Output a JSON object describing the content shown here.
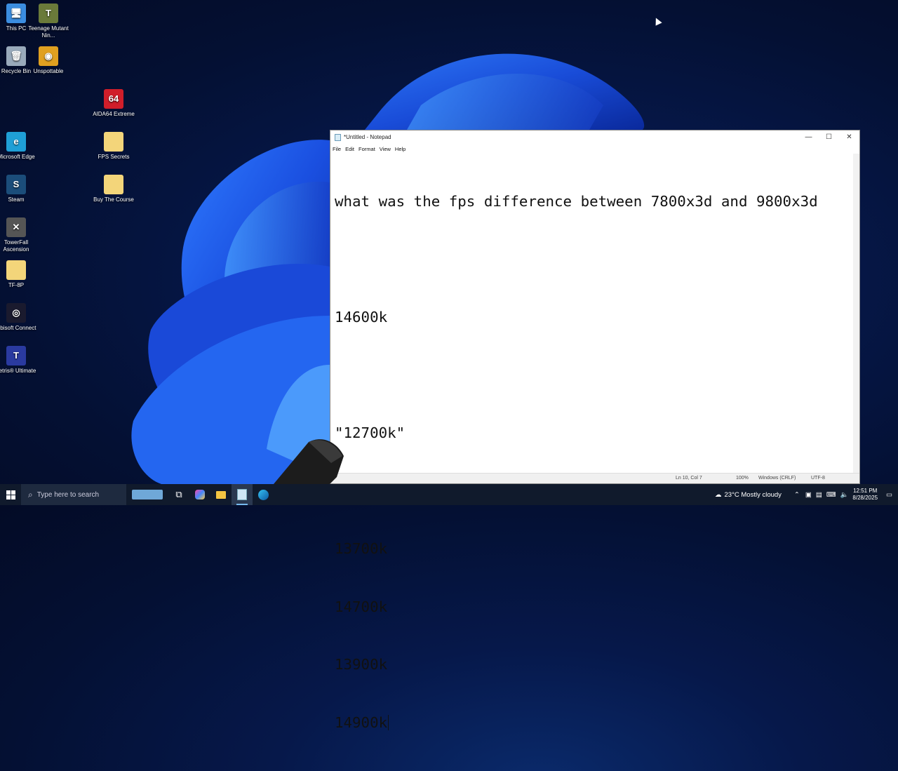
{
  "desktop_icons": [
    {
      "id": "this-pc",
      "label": "This PC",
      "glyph": "🖥",
      "color": "#3b8de0"
    },
    {
      "id": "teenage-mutant",
      "label": "Teenage Mutant Nin...",
      "glyph": "T",
      "color": "#6a7a3a"
    },
    {
      "id": "recycle-bin",
      "label": "Recycle Bin",
      "glyph": "🗑",
      "color": "#9ab"
    },
    {
      "id": "unspottable",
      "label": "Unspottable",
      "glyph": "◉",
      "color": "#e0a020"
    },
    {
      "id": "aida64",
      "label": "AIDA64 Extreme",
      "glyph": "64",
      "color": "#d01e2a"
    },
    {
      "id": "microsoft-edge",
      "label": "Microsoft Edge",
      "glyph": "e",
      "color": "#1f9fd6"
    },
    {
      "id": "fps-secrets",
      "label": "FPS Secrets",
      "glyph": "",
      "color": "#f3d57a"
    },
    {
      "id": "steam",
      "label": "Steam",
      "glyph": "S",
      "color": "#1b4d7a"
    },
    {
      "id": "buy-the-course",
      "label": "Buy The Course",
      "glyph": "",
      "color": "#f3d57a"
    },
    {
      "id": "towerfall",
      "label": "TowerFall Ascension",
      "glyph": "✕",
      "color": "#555"
    },
    {
      "id": "tf-8p",
      "label": "TF-8P",
      "glyph": "",
      "color": "#f3d57a"
    },
    {
      "id": "ubisoft-connect",
      "label": "Ubisoft Connect",
      "glyph": "◎",
      "color": "#1a1a2e"
    },
    {
      "id": "tetris",
      "label": "Tetris® Ultimate",
      "glyph": "T",
      "color": "#2a3aa0"
    }
  ],
  "notepad": {
    "title": "*Untitled - Notepad",
    "menu": [
      "File",
      "Edit",
      "Format",
      "View",
      "Help"
    ],
    "lines": [
      "what was the fps difference between 7800x3d and 9800x3d",
      "",
      "14600k",
      "",
      "\"12700k\"",
      "",
      "13700k",
      "14700k",
      "13900k",
      "14900k"
    ],
    "status": {
      "position": "Ln 10, Col 7",
      "zoom": "100%",
      "line_ending": "Windows (CRLF)",
      "encoding": "UTF-8"
    },
    "controls": {
      "minimize": "—",
      "maximize": "☐",
      "close": "✕"
    }
  },
  "taskbar": {
    "search_placeholder": "Type here to search",
    "weather": "23°C  Mostly cloudy",
    "time": "12:51 PM",
    "date": "8/28/2025"
  }
}
